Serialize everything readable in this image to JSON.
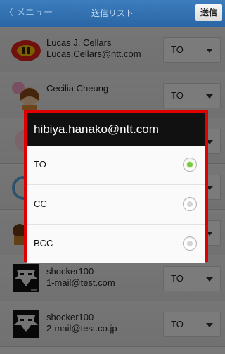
{
  "header": {
    "back_label": "〈 メニュー",
    "title": "送信リスト",
    "send_label": "送信"
  },
  "contacts": [
    {
      "name": "Lucas J. Cellars",
      "email": "Lucas.Cellars@ntt.com",
      "mode": "TO",
      "avatar": "red-ball-avatar"
    },
    {
      "name": "Cecilia Cheung",
      "email": "",
      "mode": "TO",
      "avatar": "girl-avatar"
    },
    {
      "name": "",
      "email": "",
      "mode": "",
      "avatar": "pink-avatar"
    },
    {
      "name": "",
      "email": "",
      "mode": "",
      "avatar": "blue-avatar"
    },
    {
      "name": "",
      "email": "",
      "mode": "",
      "avatar": "brown-avatar"
    },
    {
      "name": "shocker100",
      "email": "1-mail@test.com",
      "mode": "TO",
      "avatar": "mask-avatar"
    },
    {
      "name": "shocker100",
      "email": "2-mail@test.co.jp",
      "mode": "TO",
      "avatar": "mask-avatar"
    }
  ],
  "dialog": {
    "title": "hibiya.hanako@ntt.com",
    "options": [
      {
        "label": "TO",
        "selected": true
      },
      {
        "label": "CC",
        "selected": false
      },
      {
        "label": "BCC",
        "selected": false
      }
    ]
  },
  "colors": {
    "header": "#2a66a6",
    "dialog_border": "#e00000",
    "radio_selected": "#7ac943"
  }
}
